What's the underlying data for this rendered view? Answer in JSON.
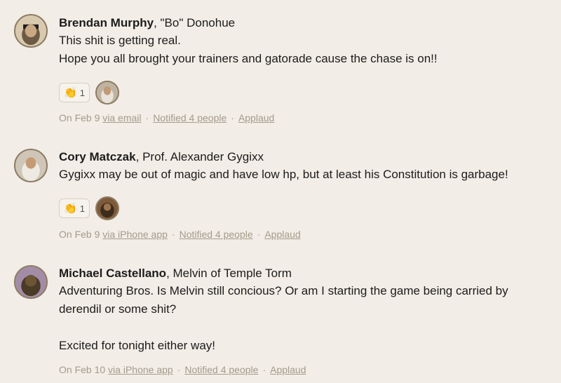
{
  "comments": [
    {
      "author": "Brendan Murphy",
      "character": "\"Bo\" Donohue",
      "lines": [
        "This shit is getting real.",
        "Hope you all brought your trainers and gatorade cause the chase is on!!"
      ],
      "boost_count": "1",
      "date": "On Feb 9",
      "via": "via email",
      "notified": "Notified 4 people",
      "applaud": "Applaud"
    },
    {
      "author": "Cory Matczak",
      "character": "Prof. Alexander Gygixx",
      "lines": [
        "Gygixx may be out of magic and have low hp, but at least his Constitution is garbage!"
      ],
      "boost_count": "1",
      "date": "On Feb 9",
      "via": "via iPhone app",
      "notified": "Notified 4 people",
      "applaud": "Applaud"
    },
    {
      "author": "Michael Castellano",
      "character": "Melvin of Temple Torm",
      "lines": [
        "Adventuring Bros. Is Melvin still concious? Or am I starting the game being carried by",
        "derendil or some shit?",
        "",
        "Excited for tonight either way!"
      ],
      "date": "On Feb 10",
      "via": "via iPhone app",
      "notified": "Notified 4 people",
      "applaud": "Applaud"
    }
  ],
  "icons": {
    "boost": "clapping-hands-icon"
  },
  "colors": {
    "background": "#f2ede6",
    "meta": "#a39b8c"
  }
}
